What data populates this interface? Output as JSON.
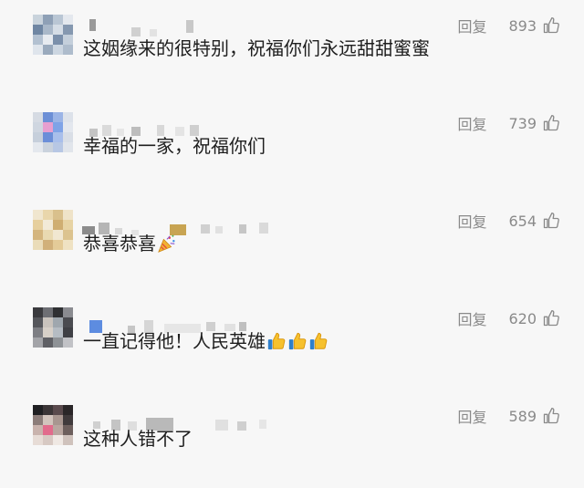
{
  "comments": [
    {
      "avatar_colors": [
        "#c9d3dc",
        "#8ea0b6",
        "#b9c6d4",
        "#e4e8ee",
        "#6f86a3",
        "#a9b8c9",
        "#d5dde6",
        "#8598b0",
        "#b3c1d1",
        "#e7ebf0",
        "#7b90ab",
        "#c4cfdb",
        "#dfe5ec",
        "#9aaabd",
        "#ccd6e1",
        "#aebccc"
      ],
      "reply_label": "回复",
      "likes": "893",
      "text": "这姻缘来的很特别，祝福你们永远甜甜蜜蜜",
      "emojis": []
    },
    {
      "avatar_colors": [
        "#d6dbe3",
        "#6c8fd6",
        "#9bb4e6",
        "#dde2ea",
        "#cfd6e0",
        "#e79fd0",
        "#7fa3e7",
        "#e3e7ee",
        "#c6cfdb",
        "#6b8ed8",
        "#a9bfeb",
        "#d9dee6",
        "#e4e8ee",
        "#cad2dd",
        "#b7c7e4",
        "#e1e5eb"
      ],
      "reply_label": "回复",
      "likes": "739",
      "text": "幸福的一家，祝福你们",
      "emojis": []
    },
    {
      "avatar_colors": [
        "#f0e6cf",
        "#e9d6ab",
        "#d9c08c",
        "#efe3c8",
        "#e6cf9d",
        "#f2ead7",
        "#cfae72",
        "#e7d3a4",
        "#d4b57e",
        "#e9d9b1",
        "#f1e7d1",
        "#dcc38f",
        "#eadcb9",
        "#d1b07a",
        "#e4cb98",
        "#efe2c3"
      ],
      "reply_label": "回复",
      "likes": "654",
      "text": "恭喜恭喜",
      "emojis": [
        "party-popper"
      ]
    },
    {
      "avatar_colors": [
        "#3a3a3e",
        "#6e6f74",
        "#2f3033",
        "#8a8b90",
        "#55565b",
        "#c9c3bd",
        "#9fa7ae",
        "#4a4b50",
        "#7d7e83",
        "#d7d0c8",
        "#b5bcc3",
        "#3f4045",
        "#a3a4a8",
        "#5f6065",
        "#8e9296",
        "#c1c2c6"
      ],
      "reply_label": "回复",
      "likes": "620",
      "text": "一直记得他！人民英雄",
      "emojis": [
        "thumbs-up",
        "thumbs-up",
        "thumbs-up"
      ]
    },
    {
      "avatar_colors": [
        "#1f1f22",
        "#3b3537",
        "#5a4a4d",
        "#2a2628",
        "#8c7d7a",
        "#d2c4bd",
        "#a89690",
        "#403a3c",
        "#c9b3ad",
        "#e26b8c",
        "#b9a6a0",
        "#6d5f5d",
        "#e7dcd6",
        "#d7c9c3",
        "#efe8e3",
        "#cfc2bc"
      ],
      "reply_label": "回复",
      "likes": "589",
      "text": "这种人错不了",
      "emojis": []
    }
  ]
}
